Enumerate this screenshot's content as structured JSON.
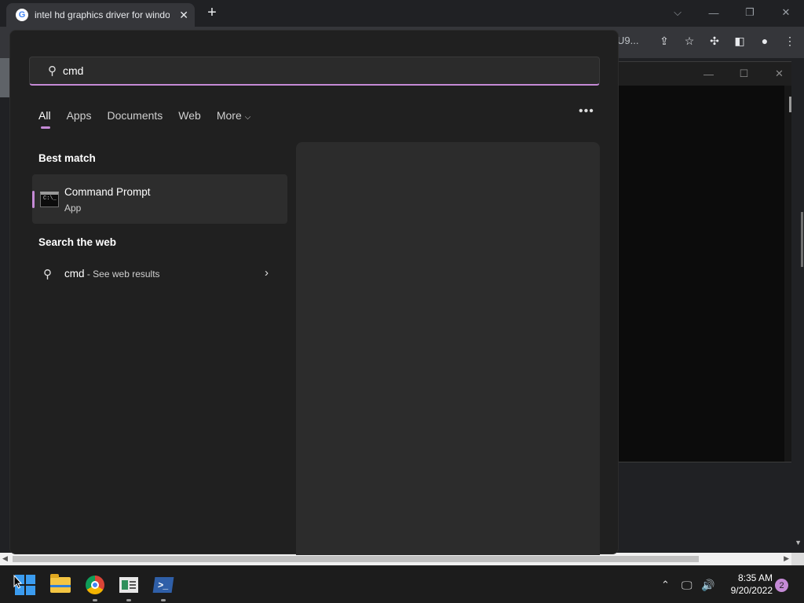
{
  "browser": {
    "tab_title": "intel hd graphics driver for windo",
    "tab_close": "✕",
    "new_tab": "+",
    "url_fragment": "U9..."
  },
  "search": {
    "query": "cmd",
    "filters": [
      "All",
      "Apps",
      "Documents",
      "Web",
      "More"
    ],
    "more_chevron": "⌵",
    "options_icon": "•••",
    "best_match_header": "Best match",
    "best_match": {
      "name": "Command Prompt",
      "type": "App"
    },
    "web_header": "Search the web",
    "web_query": "cmd",
    "web_suffix": " - See web results"
  },
  "taskbar": {
    "time": "8:35 AM",
    "date": "9/20/2022",
    "notification_count": "2",
    "apps": [
      "start-icon",
      "file-explorer-icon",
      "chrome-icon",
      "control-panel-icon",
      "powershell-icon"
    ]
  },
  "colors": {
    "accent": "#c58ad6",
    "panel_bg": "#202020",
    "preview_bg": "#2c2c2c"
  }
}
